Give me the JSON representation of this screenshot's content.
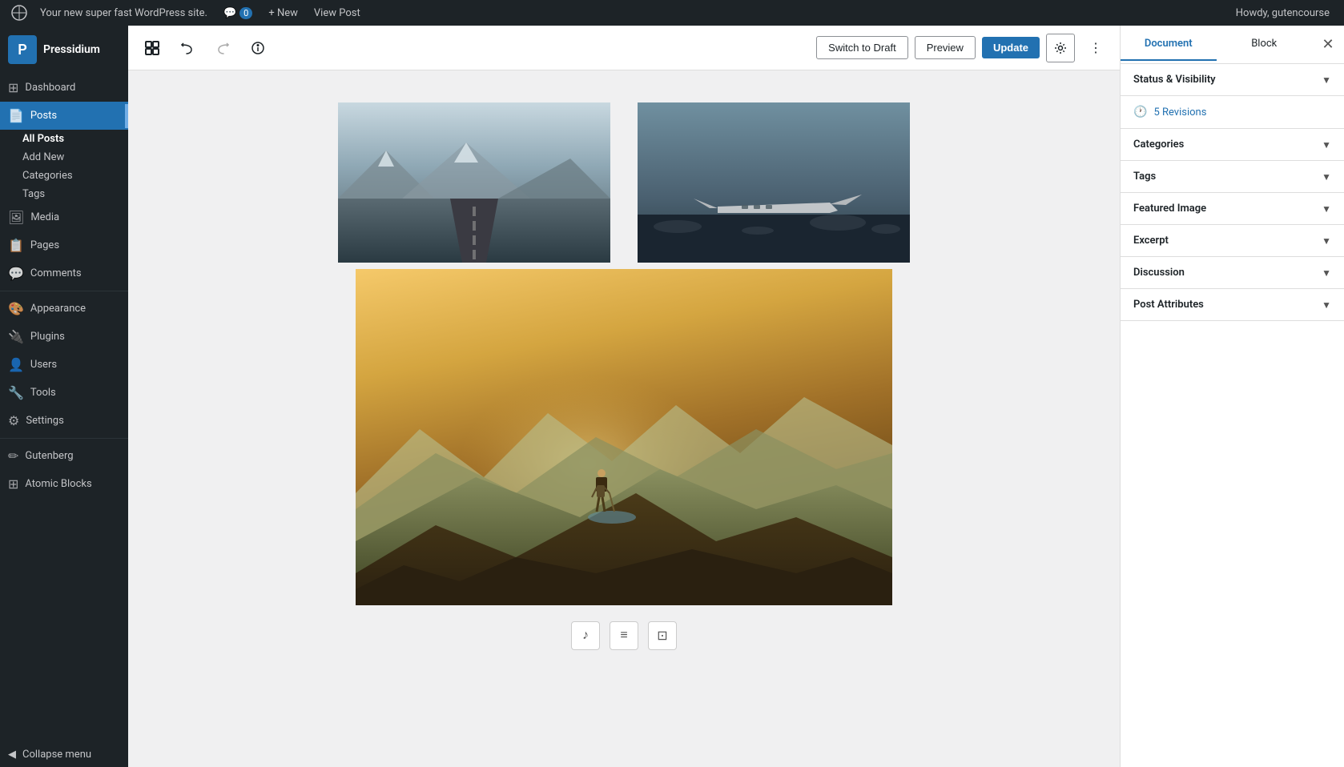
{
  "adminBar": {
    "logo": "wordpress-logo",
    "siteName": "Your new super fast WordPress site.",
    "comments": "0",
    "newLabel": "+ New",
    "viewPost": "View Post",
    "howdy": "Howdy, gutencourse"
  },
  "sidebar": {
    "brand": "Pressidium",
    "items": [
      {
        "id": "dashboard",
        "label": "Dashboard",
        "icon": "⊞"
      },
      {
        "id": "posts",
        "label": "Posts",
        "icon": "📄",
        "active": true
      },
      {
        "id": "all-posts",
        "label": "All Posts",
        "sub": true,
        "active": true
      },
      {
        "id": "add-new",
        "label": "Add New",
        "sub": true
      },
      {
        "id": "categories",
        "label": "Categories",
        "sub": true
      },
      {
        "id": "tags",
        "label": "Tags",
        "sub": true
      },
      {
        "id": "media",
        "label": "Media",
        "icon": "🖼"
      },
      {
        "id": "pages",
        "label": "Pages",
        "icon": "📋"
      },
      {
        "id": "comments",
        "label": "Comments",
        "icon": "💬"
      },
      {
        "id": "appearance",
        "label": "Appearance",
        "icon": "🎨"
      },
      {
        "id": "plugins",
        "label": "Plugins",
        "icon": "🔌"
      },
      {
        "id": "users",
        "label": "Users",
        "icon": "👤"
      },
      {
        "id": "tools",
        "label": "Tools",
        "icon": "🔧"
      },
      {
        "id": "settings",
        "label": "Settings",
        "icon": "⚙"
      },
      {
        "id": "gutenberg",
        "label": "Gutenberg",
        "icon": "✏"
      },
      {
        "id": "atomic-blocks",
        "label": "Atomic Blocks",
        "icon": "⊞"
      }
    ],
    "collapse": "Collapse menu"
  },
  "toolbar": {
    "addBlockTitle": "Add block",
    "undoTitle": "Undo",
    "redoTitle": "Redo",
    "infoTitle": "Information",
    "switchDraftLabel": "Switch to Draft",
    "previewLabel": "Preview",
    "updateLabel": "Update",
    "settingsTitle": "Settings",
    "moreTitle": "More options"
  },
  "rightPanel": {
    "documentTab": "Document",
    "blockTab": "Block",
    "closeTitle": "Close",
    "sections": [
      {
        "id": "status-visibility",
        "label": "Status & Visibility",
        "expanded": true
      },
      {
        "id": "revisions",
        "label": "5 Revisions",
        "isRevisions": true
      },
      {
        "id": "categories",
        "label": "Categories",
        "expanded": false
      },
      {
        "id": "tags",
        "label": "Tags",
        "expanded": false
      },
      {
        "id": "featured-image",
        "label": "Featured Image",
        "expanded": false
      },
      {
        "id": "excerpt",
        "label": "Excerpt",
        "expanded": false
      },
      {
        "id": "discussion",
        "label": "Discussion",
        "expanded": false
      },
      {
        "id": "post-attributes",
        "label": "Post Attributes",
        "expanded": false
      }
    ]
  },
  "gallery": {
    "actionButtons": [
      {
        "id": "audio",
        "icon": "♪",
        "title": "Audio"
      },
      {
        "id": "list",
        "icon": "≡",
        "title": "List"
      },
      {
        "id": "image",
        "icon": "⊡",
        "title": "Image"
      }
    ]
  }
}
